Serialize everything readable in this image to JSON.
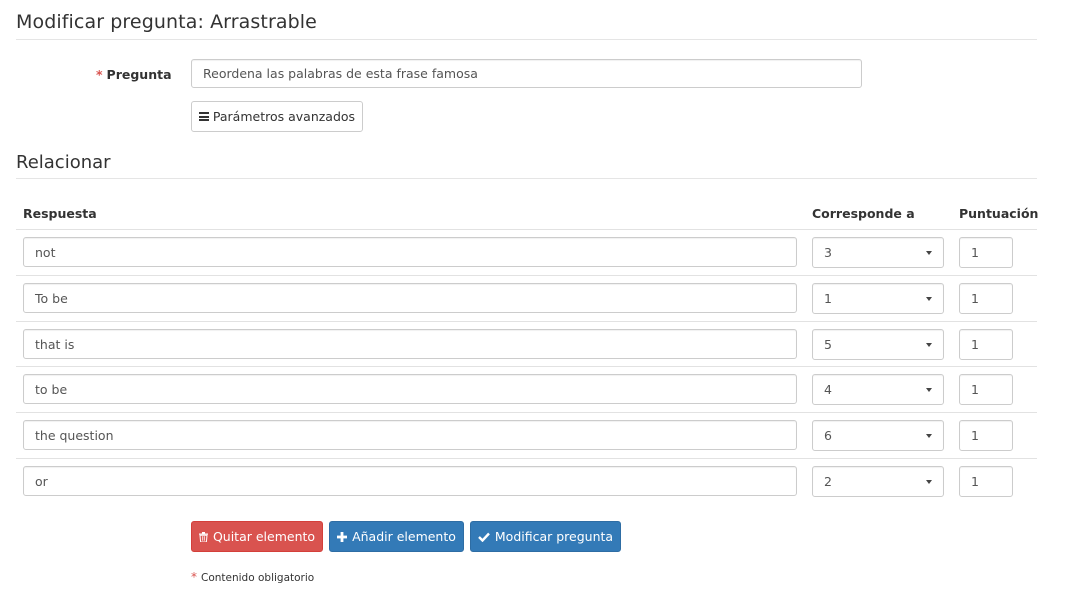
{
  "page": {
    "title": "Modificar pregunta: Arrastrable"
  },
  "question": {
    "required_mark": "*",
    "label": "Pregunta",
    "value": "Reordena las palabras de esta frase famosa"
  },
  "advanced_button": {
    "label": "Parámetros avanzados",
    "icon": "bars-icon"
  },
  "section": {
    "title": "Relacionar"
  },
  "table": {
    "headers": {
      "answer": "Respuesta",
      "matches": "Corresponde a",
      "score": "Puntuación"
    },
    "rows": [
      {
        "answer": "not",
        "matches": "3",
        "score": "1"
      },
      {
        "answer": "To be",
        "matches": "1",
        "score": "1"
      },
      {
        "answer": "that is",
        "matches": "5",
        "score": "1"
      },
      {
        "answer": "to be",
        "matches": "4",
        "score": "1"
      },
      {
        "answer": "the question",
        "matches": "6",
        "score": "1"
      },
      {
        "answer": "or",
        "matches": "2",
        "score": "1"
      }
    ]
  },
  "actions": {
    "remove": {
      "label": "Quitar elemento",
      "icon": "trash-icon",
      "color": "#d9534f"
    },
    "add": {
      "label": "Añadir elemento",
      "icon": "plus-icon",
      "color": "#337ab7"
    },
    "modify": {
      "label": "Modificar pregunta",
      "icon": "check-icon",
      "color": "#337ab7"
    }
  },
  "footer": {
    "required_mark": "*",
    "note": "Contenido obligatorio"
  }
}
